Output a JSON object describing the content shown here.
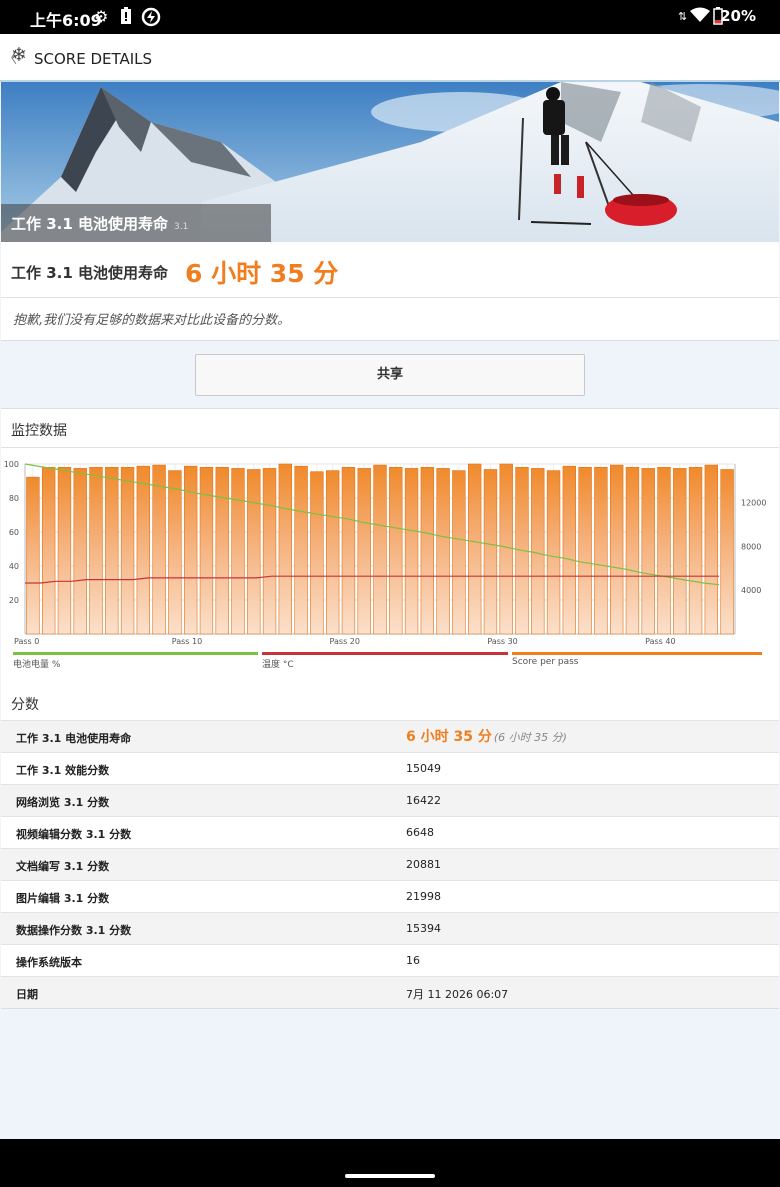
{
  "status_bar": {
    "time": "上午6:09",
    "battery": "20%"
  },
  "header": {
    "title": "SCORE DETAILS"
  },
  "hero": {
    "title": "工作 3.1 电池使用寿命",
    "version": "3.1"
  },
  "result": {
    "name": "工作 3.1 电池使用寿命",
    "value": "6 小时 35 分",
    "note": "抱歉,我们没有足够的数据来对比此设备的分数。"
  },
  "share_label": "共享",
  "monitor": {
    "title": "监控数据",
    "scores_title": "分数",
    "legend": [
      {
        "label": "电池电量 %",
        "color": "#7cc043"
      },
      {
        "label": "温度 °C",
        "color": "#c7343a"
      },
      {
        "label": "Score per pass",
        "color": "#f07d1e"
      }
    ]
  },
  "chart_data": {
    "type": "bar",
    "x_ticks": [
      "Pass 0",
      "Pass 10",
      "Pass 20",
      "Pass 30",
      "Pass 40"
    ],
    "left_ticks": [
      "100",
      "80",
      "60",
      "40",
      "20"
    ],
    "right_ticks": [
      "12000",
      "8000",
      "4000"
    ],
    "ylim_left": [
      0,
      100
    ],
    "ylim_right": [
      0,
      15500
    ],
    "grid": true,
    "series": [
      {
        "name": "Score per pass",
        "axis": "right",
        "color": "#f07d1e",
        "values": [
          14300,
          15200,
          15200,
          15100,
          15200,
          15200,
          15200,
          15300,
          15400,
          14900,
          15300,
          15200,
          15200,
          15100,
          15000,
          15100,
          15500,
          15300,
          14800,
          14900,
          15200,
          15100,
          15400,
          15200,
          15100,
          15200,
          15100,
          14900,
          15500,
          15000,
          15500,
          15200,
          15100,
          14900,
          15300,
          15200,
          15200,
          15400,
          15200,
          15100,
          15200,
          15100,
          15200,
          15400,
          15000
        ]
      },
      {
        "name": "电池电量 %",
        "axis": "left",
        "color": "#7cc043",
        "values": [
          100,
          98.5,
          97,
          95.5,
          94,
          92.5,
          91,
          89.5,
          88,
          86.5,
          85,
          83,
          81.5,
          80,
          78.5,
          77,
          75.5,
          73.5,
          72,
          70.5,
          69,
          67.5,
          65.5,
          64,
          62.5,
          61,
          59.5,
          57.5,
          56,
          54.5,
          53,
          51.5,
          49.5,
          48,
          46,
          44.5,
          42.5,
          41,
          39.5,
          38,
          36,
          34.5,
          33,
          31.5,
          30,
          29
        ]
      },
      {
        "name": "温度 °C",
        "axis": "left",
        "color": "#c7343a",
        "values": [
          30,
          30,
          31,
          31,
          32,
          32,
          32,
          32,
          33,
          33,
          33,
          33,
          33,
          33,
          33,
          33,
          34,
          34,
          34,
          34,
          34,
          34,
          34,
          34,
          34,
          34,
          34,
          34,
          34,
          34,
          34,
          34,
          34,
          34,
          34,
          34,
          34,
          34,
          34,
          34,
          34,
          34,
          34,
          34,
          34,
          34
        ]
      }
    ]
  },
  "table": [
    {
      "label": "工作 3.1 电池使用寿命",
      "value": "6 小时 35 分",
      "extra": "(6 小时 35 分)",
      "highlight": true
    },
    {
      "label": "工作 3.1 效能分数",
      "value": "15049"
    },
    {
      "label": "网络浏览 3.1 分数",
      "value": "16422"
    },
    {
      "label": "视频编辑分数 3.1 分数",
      "value": "6648"
    },
    {
      "label": "文档编写 3.1 分数",
      "value": "20881"
    },
    {
      "label": "图片编辑 3.1 分数",
      "value": "21998"
    },
    {
      "label": "数据操作分数 3.1 分数",
      "value": "15394"
    },
    {
      "label": "操作系统版本",
      "value": "16"
    },
    {
      "label": "日期",
      "value": "7月 11 2026 06:07"
    }
  ]
}
